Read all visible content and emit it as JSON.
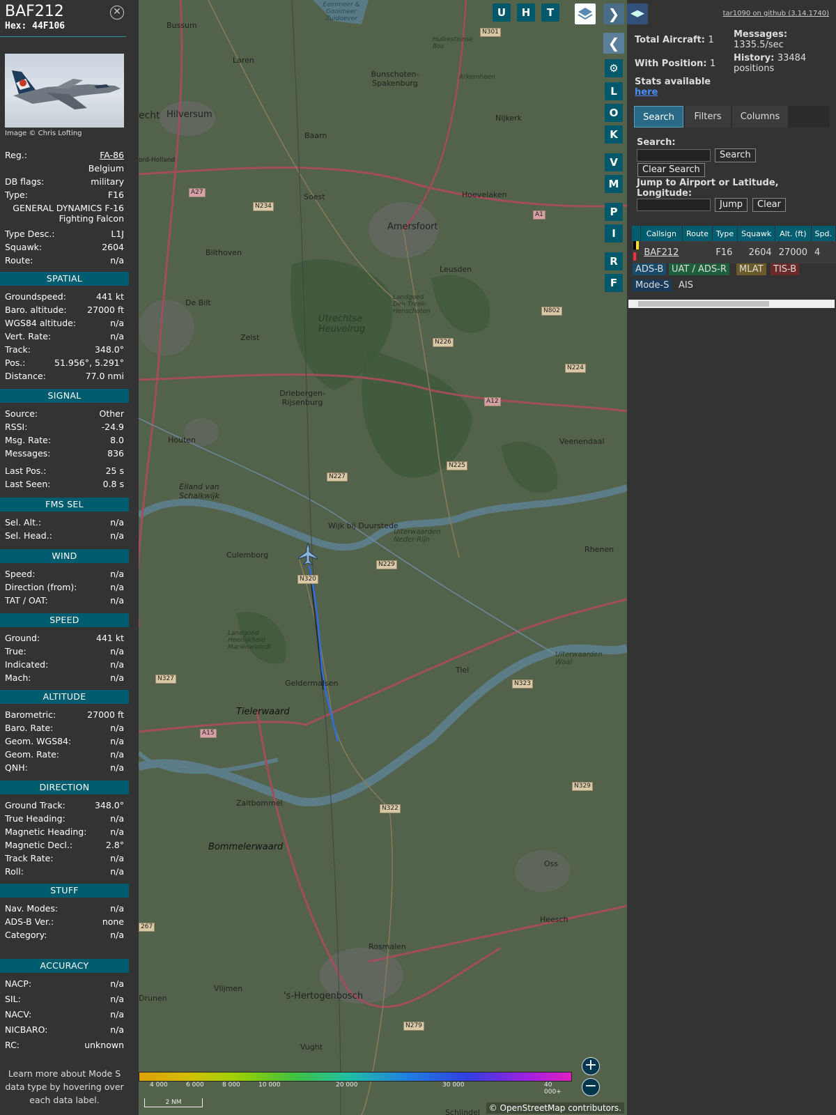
{
  "info": {
    "callsign": "BAF212",
    "hex_label": "Hex:",
    "hex": "44F106",
    "close_icon": "close-icon",
    "photo_credit": "Image © Chris Lofting",
    "reg_label": "Reg.:",
    "reg": "FA-86",
    "country": "Belgium",
    "dbflags_label": "DB flags:",
    "dbflags": "military",
    "type_label": "Type:",
    "type": "F16",
    "type_full_1": "GENERAL DYNAMICS F-16",
    "type_full_2": "Fighting Falcon",
    "typedesc_label": "Type Desc.:",
    "typedesc": "L1J",
    "squawk_label": "Squawk:",
    "squawk": "2604",
    "route_label": "Route:",
    "route": "n/a",
    "learn_more": [
      "Learn more about Mode S",
      "data type by hovering over",
      "each data label."
    ]
  },
  "sections": {
    "spatial": {
      "title": "SPATIAL",
      "rows": [
        {
          "label": "Groundspeed:",
          "value": "441 kt"
        },
        {
          "label": "Baro. altitude:",
          "value": "27000 ft"
        },
        {
          "label": "WGS84 altitude:",
          "value": "n/a"
        },
        {
          "label": "Vert. Rate:",
          "value": "n/a"
        },
        {
          "label": "Track:",
          "value": "348.0°"
        },
        {
          "label": "Pos.:",
          "value": "51.956°, 5.291°"
        },
        {
          "label": "Distance:",
          "value": "77.0 nmi"
        }
      ]
    },
    "signal": {
      "title": "SIGNAL",
      "rows": [
        {
          "label": "Source:",
          "value": "Other"
        },
        {
          "label": "RSSI:",
          "value": "-24.9"
        },
        {
          "label": "Msg. Rate:",
          "value": "8.0"
        },
        {
          "label": "Messages:",
          "value": "836"
        },
        {
          "label": "Last Pos.:",
          "value": "25 s"
        },
        {
          "label": "Last Seen:",
          "value": "0.8 s"
        }
      ]
    },
    "fms": {
      "title": "FMS SEL",
      "rows": [
        {
          "label": "Sel. Alt.:",
          "value": "n/a"
        },
        {
          "label": "Sel. Head.:",
          "value": "n/a"
        }
      ]
    },
    "wind": {
      "title": "WIND",
      "rows": [
        {
          "label": "Speed:",
          "value": "n/a"
        },
        {
          "label": "Direction (from):",
          "value": "n/a"
        },
        {
          "label": "TAT / OAT:",
          "value": "n/a"
        }
      ]
    },
    "speed": {
      "title": "SPEED",
      "rows": [
        {
          "label": "Ground:",
          "value": "441 kt"
        },
        {
          "label": "True:",
          "value": "n/a"
        },
        {
          "label": "Indicated:",
          "value": "n/a"
        },
        {
          "label": "Mach:",
          "value": "n/a"
        }
      ]
    },
    "altitude": {
      "title": "ALTITUDE",
      "rows": [
        {
          "label": "Barometric:",
          "value": "27000 ft"
        },
        {
          "label": "Baro. Rate:",
          "value": "n/a"
        },
        {
          "label": "Geom. WGS84:",
          "value": "n/a"
        },
        {
          "label": "Geom. Rate:",
          "value": "n/a"
        },
        {
          "label": "QNH:",
          "value": "n/a"
        }
      ]
    },
    "direction": {
      "title": "DIRECTION",
      "rows": [
        {
          "label": "Ground Track:",
          "value": "348.0°"
        },
        {
          "label": "True Heading:",
          "value": "n/a"
        },
        {
          "label": "Magnetic Heading:",
          "value": "n/a"
        },
        {
          "label": "Magnetic Decl.:",
          "value": "2.8°"
        },
        {
          "label": "Track Rate:",
          "value": "n/a"
        },
        {
          "label": "Roll:",
          "value": "n/a"
        }
      ]
    },
    "stuff": {
      "title": "STUFF",
      "rows": [
        {
          "label": "Nav. Modes:",
          "value": "n/a"
        },
        {
          "label": "ADS-B Ver.:",
          "value": "none"
        },
        {
          "label": "Category:",
          "value": "n/a"
        }
      ]
    },
    "accuracy": {
      "title": "ACCURACY",
      "rows": [
        {
          "label": "NACP:",
          "value": "n/a"
        },
        {
          "label": "SIL:",
          "value": "n/a"
        },
        {
          "label": "NACV:",
          "value": "n/a"
        },
        {
          "label": "NICBARO:",
          "value": "n/a"
        },
        {
          "label": "RC:",
          "value": "unknown"
        }
      ]
    }
  },
  "map": {
    "top_buttons": [
      "U",
      "H",
      "T"
    ],
    "layers_icon": "layers-icon",
    "side_buttons": [
      "L",
      "O",
      "K",
      "V",
      "M",
      "P",
      "I",
      "R",
      "F"
    ],
    "settings_icon": "gear-icon",
    "expand_icon": "chevron-right-icon",
    "collapse_icon": "chevron-left-icon",
    "split_icon": "split-arrows-icon",
    "places": [
      "Bussum",
      "Laren",
      "Hilversum",
      "Bunschoten-Spakenburg",
      "Baarn",
      "Nijkerk",
      "Soest",
      "Hoevelaken",
      "Amersfoort",
      "Bilthoven",
      "Leusden",
      "De Bilt",
      "Utrechtse Heuvelrug",
      "Zeist",
      "Driebergen-Rijsenburg",
      "Houten",
      "Veenendaal",
      "Eiland van Schalkwijk",
      "Wijk bij Duurstede",
      "Culemborg",
      "Rhenen",
      "Geldermalsen",
      "Tielerwaard",
      "Tiel",
      "Zaltbommel",
      "Bommelerwaard",
      "Oss",
      "Heesch",
      "Rosmalen",
      "Vlijmen",
      "'s-Hertogenbosch",
      "Drunen",
      "Vught",
      "Schijndel",
      "Eemmeer & Gooimeer Zuidoever",
      "Hulkesteinse Bos",
      "Arkemheen",
      "Landgoed Den Treek-Henschoten",
      "Uiterwaarden Neder-Rijn",
      "Landgoed Heerlijkheid Mariënwaerdt",
      "Uiterwaarden Waal",
      "echt",
      "ord-Holland"
    ],
    "roads": [
      "N301",
      "A27",
      "N234",
      "A1",
      "N802",
      "N226",
      "N224",
      "A12",
      "N225",
      "N227",
      "N229",
      "N320",
      "N323",
      "N327",
      "A15",
      "N322",
      "N329",
      "N279",
      "267"
    ],
    "altitude_legend": [
      "4 000",
      "6 000",
      "8 000",
      "10 000",
      "20 000",
      "30 000",
      "40 000+"
    ],
    "scale": "2 NM",
    "zoom_in_icon": "plus-icon",
    "zoom_out_icon": "minus-icon",
    "attribution_prefix": "©",
    "attribution_link": "OpenStreetMap",
    "attribution_suffix": "contributors."
  },
  "panel": {
    "github": "tar1090 on github (3.14.1740)",
    "total_label": "Total Aircraft:",
    "total": "1",
    "messages_label": "Messages:",
    "messages": "1335.5/sec",
    "withpos_label": "With Position:",
    "withpos": "1",
    "history_label": "History:",
    "history": "33484",
    "history_unit": "positions",
    "stats_label": "Stats available",
    "stats_link": "here",
    "tabs": [
      "Search",
      "Filters",
      "Columns"
    ],
    "search_label": "Search:",
    "search_value": "",
    "search_button": "Search",
    "clear_search_button": "Clear Search",
    "jump_label_1": "Jump to Airport or Latitude,",
    "jump_label_2": "Longitude:",
    "jump_value": "",
    "jump_button": "Jump",
    "clear_button": "Clear",
    "table": {
      "columns": [
        "",
        "Callsign",
        "Route",
        "Type",
        "Squawk",
        "Alt. (ft)",
        "Spd."
      ],
      "rows": [
        {
          "flag": "belgium-flag-icon",
          "callsign": "BAF212",
          "route": "",
          "type": "F16",
          "squawk": "2604",
          "alt": "27000",
          "spd": "4"
        }
      ]
    },
    "sources": [
      "ADS-B",
      "UAT / ADS-R",
      "MLAT",
      "TIS-B",
      "Mode-S",
      "AIS"
    ],
    "source_colors": {
      "ADS-B": "#1a4a6a",
      "UAT / ADS-R": "#1f5e3a",
      "MLAT": "#6b5a2a",
      "TIS-B": "#6a2a2a",
      "Mode-S": "#1a3a5a",
      "AIS": "#333333"
    }
  }
}
